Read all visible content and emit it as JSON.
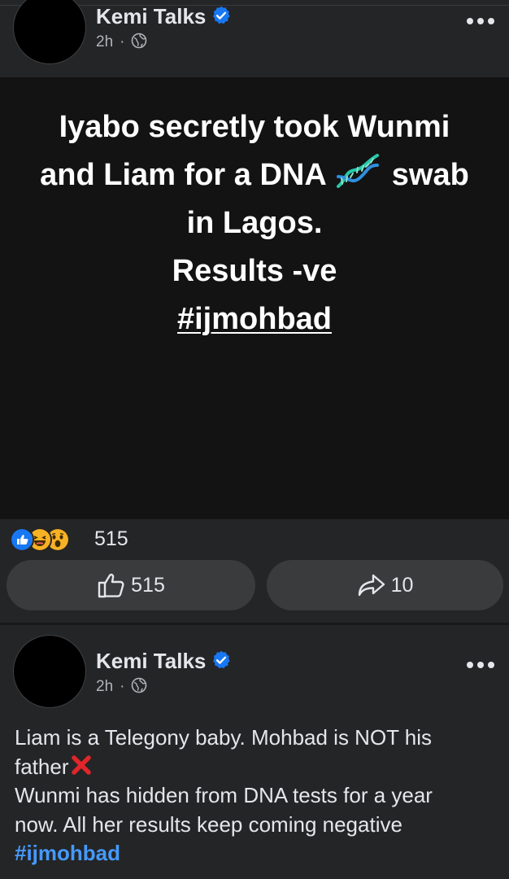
{
  "post1": {
    "author": "Kemi Talks",
    "time": "2h",
    "separator": "·",
    "headline": {
      "line1": "Iyabo secretly took Wunmi",
      "line2a": "and Liam for a DNA",
      "line2b": "swab",
      "line3": "in Lagos.",
      "line4": "Results -ve",
      "hashtag": "#ijmohbad"
    },
    "reaction_count": "515",
    "like_count": "515",
    "share_count": "10"
  },
  "post2": {
    "author": "Kemi Talks",
    "time": "2h",
    "separator": "·",
    "text": {
      "line1": "Liam is a Telegony baby. Mohbad is NOT his",
      "line2": "father",
      "line3": "Wunmi has hidden from DNA tests for a year",
      "line4": "now. All her results keep coming negative",
      "hashtag": "#ijmohbad"
    }
  },
  "icons": {
    "verified": "verified-badge-icon",
    "globe": "globe-icon",
    "more": "more-options-icon",
    "dna": "dna-emoji-icon",
    "like_reaction": "like-reaction-icon",
    "haha_reaction": "haha-reaction-icon",
    "wow_reaction": "wow-reaction-icon",
    "thumb": "thumbs-up-icon",
    "share": "share-arrow-icon",
    "cross": "red-cross-emoji-icon"
  },
  "colors": {
    "background": "#18191a",
    "card": "#242526",
    "pill": "#3a3b3c",
    "text": "#e4e6eb",
    "secondary_text": "#b0b3b8",
    "hashtag": "#4599ff",
    "verified": "#1877f2"
  }
}
